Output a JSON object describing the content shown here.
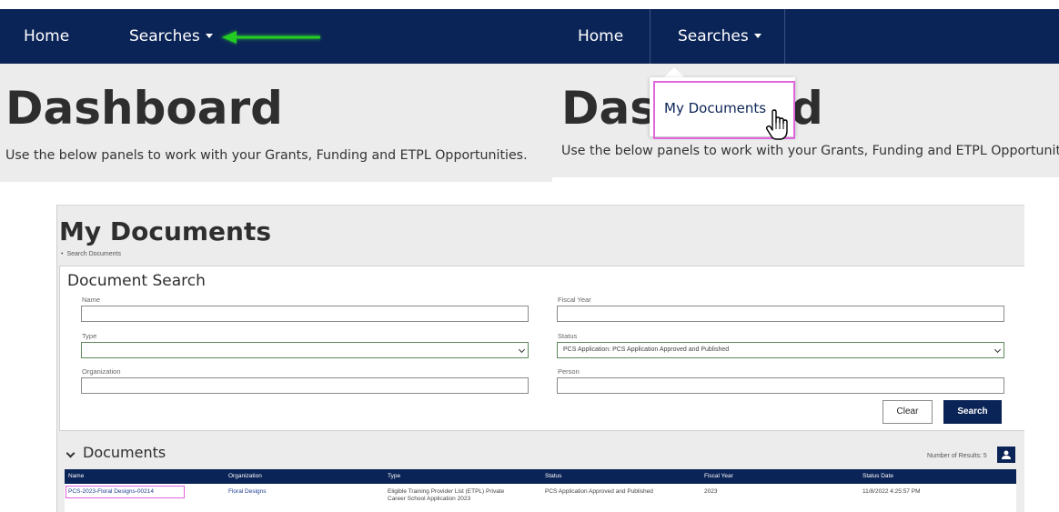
{
  "nav": {
    "home": "Home",
    "searches": "Searches"
  },
  "dashboard": {
    "title": "Dashboard",
    "subtitle": "Use the below panels to work with your Grants, Funding and ETPL Opportunities.",
    "title_partial_left": "Das",
    "title_partial_right": "d"
  },
  "dropdown": {
    "item": "My Documents"
  },
  "my_documents": {
    "title": "My Documents",
    "breadcrumb": "Search Documents"
  },
  "search": {
    "title": "Document Search",
    "name_label": "Name",
    "name_value": "",
    "fiscal_year_label": "Fiscal Year",
    "fiscal_year_value": "",
    "type_label": "Type",
    "type_value": "",
    "status_label": "Status",
    "status_value": "PCS Application: PCS Application Approved and Published",
    "organization_label": "Organization",
    "organization_value": "",
    "person_label": "Person",
    "person_value": "",
    "clear_label": "Clear",
    "search_label": "Search"
  },
  "documents": {
    "title": "Documents",
    "results_label": "Number of Results: 5",
    "columns": [
      "Name",
      "Organization",
      "Type",
      "Status",
      "Fiscal Year",
      "Status Date"
    ],
    "rows": [
      {
        "name": "PCS-2023-Floral Designs-00214",
        "organization": "Floral Designs",
        "type_line1": "Eligible Training Provider List (ETPL) Private",
        "type_line2": "Career School Application 2023",
        "status": "PCS Application Approved and Published",
        "fiscal_year": "2023",
        "status_date": "11/8/2022 4:25:57 PM"
      }
    ]
  },
  "colors": {
    "navy": "#0b2457",
    "highlight": "#e066e0",
    "arrow": "#33cc33"
  }
}
